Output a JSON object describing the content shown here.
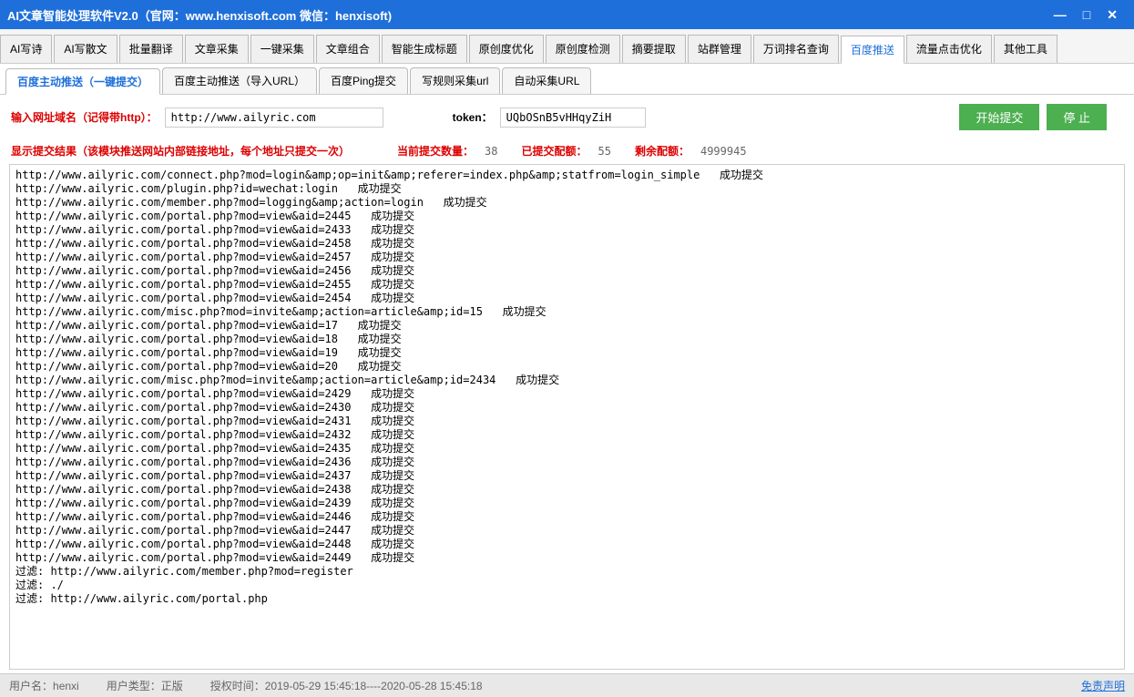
{
  "window": {
    "title": "AI文章智能处理软件V2.0（官网：www.henxisoft.com  微信：henxisoft)"
  },
  "main_tabs": [
    "AI写诗",
    "AI写散文",
    "批量翻译",
    "文章采集",
    "一键采集",
    "文章组合",
    "智能生成标题",
    "原创度优化",
    "原创度检测",
    "摘要提取",
    "站群管理",
    "万词排名查询",
    "百度推送",
    "流量点击优化",
    "其他工具"
  ],
  "active_main_tab": 12,
  "sub_tabs": [
    "百度主动推送（一键提交）",
    "百度主动推送（导入URL）",
    "百度Ping提交",
    "写规则采集url",
    "自动采集URL"
  ],
  "active_sub_tab": 0,
  "form": {
    "domain_label": "输入网址域名（记得带http）：",
    "domain_value": "http://www.ailyric.com",
    "token_label": "token：",
    "token_value": "UQbOSnB5vHHqyZiH",
    "start_btn": "开始提交",
    "stop_btn": "停  止"
  },
  "stats": {
    "result_label": "显示提交结果（该模块推送网站内部链接地址，每个地址只提交一次）",
    "current_label": "当前提交数量：",
    "current_value": "38",
    "submitted_label": "已提交配额：",
    "submitted_value": "55",
    "remain_label": "剩余配额：",
    "remain_value": "4999945"
  },
  "log_lines": [
    "http://www.ailyric.com/connect.php?mod=login&amp;op=init&amp;referer=index.php&amp;statfrom=login_simple   成功提交",
    "http://www.ailyric.com/plugin.php?id=wechat:login   成功提交",
    "http://www.ailyric.com/member.php?mod=logging&amp;action=login   成功提交",
    "http://www.ailyric.com/portal.php?mod=view&aid=2445   成功提交",
    "http://www.ailyric.com/portal.php?mod=view&aid=2433   成功提交",
    "http://www.ailyric.com/portal.php?mod=view&aid=2458   成功提交",
    "http://www.ailyric.com/portal.php?mod=view&aid=2457   成功提交",
    "http://www.ailyric.com/portal.php?mod=view&aid=2456   成功提交",
    "http://www.ailyric.com/portal.php?mod=view&aid=2455   成功提交",
    "http://www.ailyric.com/portal.php?mod=view&aid=2454   成功提交",
    "http://www.ailyric.com/misc.php?mod=invite&amp;action=article&amp;id=15   成功提交",
    "http://www.ailyric.com/portal.php?mod=view&aid=17   成功提交",
    "http://www.ailyric.com/portal.php?mod=view&aid=18   成功提交",
    "http://www.ailyric.com/portal.php?mod=view&aid=19   成功提交",
    "http://www.ailyric.com/portal.php?mod=view&aid=20   成功提交",
    "http://www.ailyric.com/misc.php?mod=invite&amp;action=article&amp;id=2434   成功提交",
    "http://www.ailyric.com/portal.php?mod=view&aid=2429   成功提交",
    "http://www.ailyric.com/portal.php?mod=view&aid=2430   成功提交",
    "http://www.ailyric.com/portal.php?mod=view&aid=2431   成功提交",
    "http://www.ailyric.com/portal.php?mod=view&aid=2432   成功提交",
    "http://www.ailyric.com/portal.php?mod=view&aid=2435   成功提交",
    "http://www.ailyric.com/portal.php?mod=view&aid=2436   成功提交",
    "http://www.ailyric.com/portal.php?mod=view&aid=2437   成功提交",
    "http://www.ailyric.com/portal.php?mod=view&aid=2438   成功提交",
    "http://www.ailyric.com/portal.php?mod=view&aid=2439   成功提交",
    "http://www.ailyric.com/portal.php?mod=view&aid=2446   成功提交",
    "http://www.ailyric.com/portal.php?mod=view&aid=2447   成功提交",
    "http://www.ailyric.com/portal.php?mod=view&aid=2448   成功提交",
    "http://www.ailyric.com/portal.php?mod=view&aid=2449   成功提交",
    "",
    "过滤: http://www.ailyric.com/member.php?mod=register",
    "过滤: ./",
    "过滤: http://www.ailyric.com/portal.php"
  ],
  "status": {
    "user_label": "用户名：",
    "user_value": "henxi",
    "type_label": "用户类型：",
    "type_value": "正版",
    "auth_label": "授权时间：",
    "auth_value": "2019-05-29 15:45:18----2020-05-28 15:45:18",
    "disclaimer": "免责声明"
  }
}
